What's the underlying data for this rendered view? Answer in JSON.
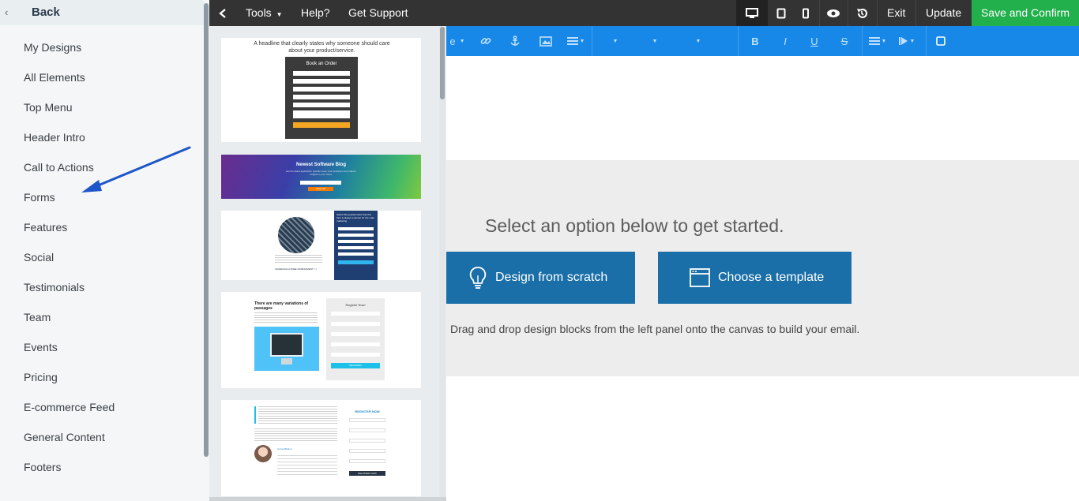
{
  "sidebar": {
    "back_label": "Back",
    "items": [
      {
        "label": "My Designs"
      },
      {
        "label": "All Elements"
      },
      {
        "label": "Top Menu"
      },
      {
        "label": "Header Intro"
      },
      {
        "label": "Call to Actions"
      },
      {
        "label": "Forms"
      },
      {
        "label": "Features"
      },
      {
        "label": "Social"
      },
      {
        "label": "Testimonials"
      },
      {
        "label": "Team"
      },
      {
        "label": "Events"
      },
      {
        "label": "Pricing"
      },
      {
        "label": "E-commerce Feed"
      },
      {
        "label": "General Content"
      },
      {
        "label": "Footers"
      }
    ],
    "annotation_arrow_color": "#1e56c8"
  },
  "thumbnails": [
    {
      "title": "A headline that clearly states why someone should care about your product/service.",
      "form_title": "Book an Order"
    },
    {
      "title": "Newest Software Blog",
      "subtitle": "Get the latest application specific news, best practices and industry insights in your inbox.",
      "button": "SIGN UP"
    },
    {
      "side_title": "Select this popular tactic that this form is always a winner for the main marketing",
      "cta": "SCHEDULE A FREE ASSESSMENT >>"
    },
    {
      "title": "There are many variations of passages",
      "form_title": "Register Now!",
      "button": "REGISTER"
    },
    {
      "form_title": "REGISTER NOW",
      "person_name": "Anna Wilsdon",
      "button": "REGISTER NOW"
    }
  ],
  "topbar": {
    "tools_label": "Tools",
    "help_label": "Help?",
    "support_label": "Get Support",
    "exit_label": "Exit",
    "update_label": "Update",
    "save_label": "Save and Confirm",
    "save_color": "#21b04b"
  },
  "editbar": {
    "style_fragment": "e",
    "bold": "B",
    "italic": "I",
    "underline": "U",
    "strike": "S"
  },
  "canvas": {
    "prompt": "Select an option below to get started.",
    "design_scratch": "Design from scratch",
    "choose_template": "Choose a template",
    "helptext": "Drag and drop design blocks from the left panel onto the canvas to build your email.",
    "button_color": "#1a6fa8"
  }
}
